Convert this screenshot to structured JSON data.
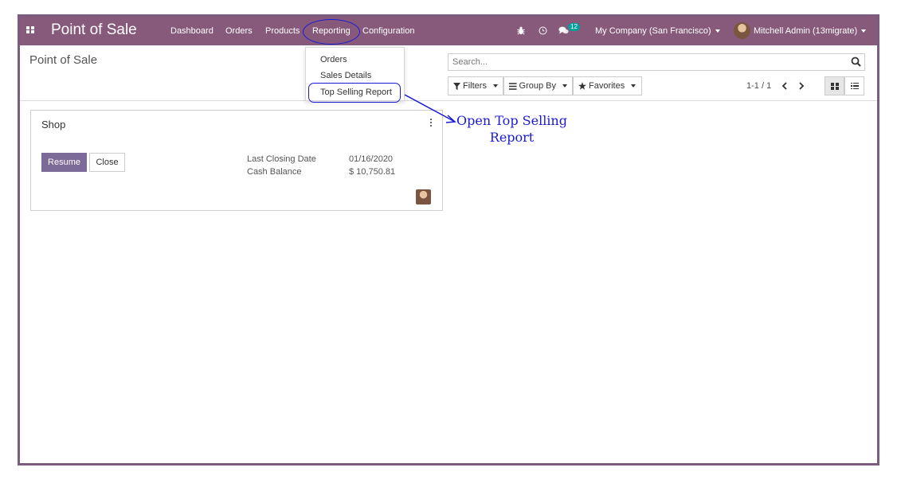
{
  "navbar": {
    "app_title": "Point of Sale",
    "menu": [
      "Dashboard",
      "Orders",
      "Products",
      "Reporting",
      "Configuration"
    ],
    "chat_count": "12",
    "company": "My Company (San Francisco)",
    "user": "Mitchell Admin (13migrate)"
  },
  "reporting_dropdown": {
    "items": [
      "Orders",
      "Sales Details",
      "Top Selling Report"
    ]
  },
  "control_panel": {
    "breadcrumb": "Point of Sale",
    "search_placeholder": "Search...",
    "filters_label": "Filters",
    "group_by_label": "Group By",
    "favorites_label": "Favorites",
    "pager": "1-1 / 1"
  },
  "card": {
    "title": "Shop",
    "resume_label": "Resume",
    "close_label": "Close",
    "last_closing_label": "Last Closing Date",
    "last_closing_value": "01/16/2020",
    "cash_balance_label": "Cash Balance",
    "cash_balance_value": "$ 10,750.81"
  },
  "annotation": {
    "line1": "Open Top Selling",
    "line2": "Report"
  },
  "colors": {
    "navbar": "#875a7b",
    "primary_button": "#7c6a98",
    "annotation": "#1a1ad6",
    "frame": "#7c5c7e"
  }
}
